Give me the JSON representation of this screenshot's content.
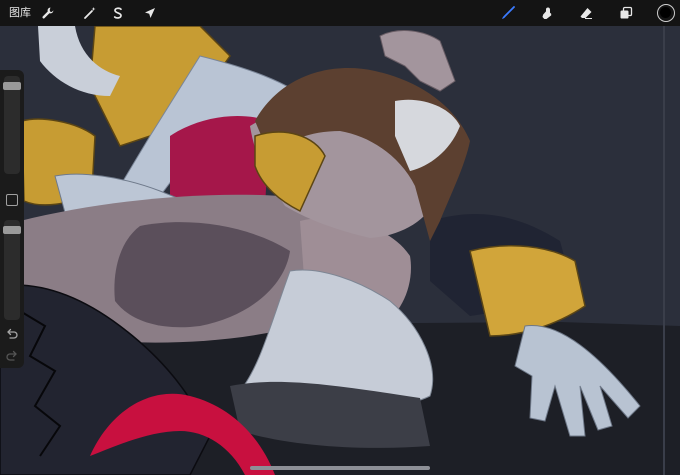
{
  "topbar": {
    "gallery_label": "图库"
  },
  "actions": [
    {
      "name": "actions-wrench"
    },
    {
      "name": "adjustments-wand"
    },
    {
      "name": "selection-s"
    },
    {
      "name": "transform-arrow"
    }
  ],
  "tools": [
    {
      "name": "brush",
      "active": true,
      "color": "#3b7bff"
    },
    {
      "name": "smudge",
      "active": false
    },
    {
      "name": "eraser",
      "active": false
    },
    {
      "name": "layers",
      "active": false
    }
  ],
  "current_color": "#000000",
  "sidebar": {
    "brush_size": 0.95,
    "opacity": 0.95
  }
}
